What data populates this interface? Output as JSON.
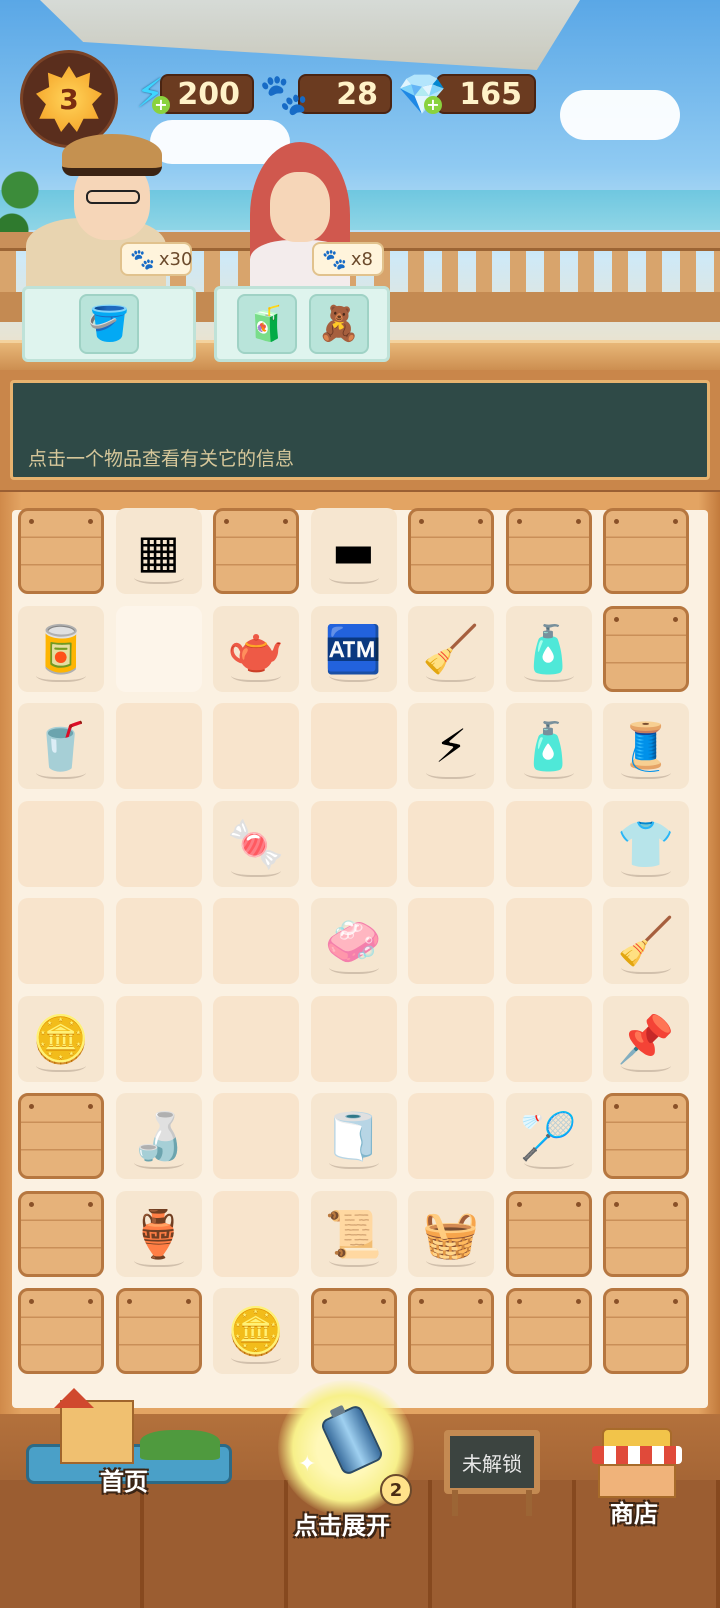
{
  "hud": {
    "level": "3",
    "energy": "200",
    "paws": "28",
    "gems": "165"
  },
  "customers": [
    {
      "name": "man-with-hat",
      "reward": "x30",
      "orders": [
        "bucket"
      ]
    },
    {
      "name": "woman-red-hair",
      "reward": "x8",
      "orders": [
        "juice-cup",
        "pink-towel"
      ]
    }
  ],
  "info": {
    "hint": "点击一个物品查看有关它的信息"
  },
  "board": {
    "rows": [
      [
        "crate",
        "grill",
        "crate",
        "plank",
        "crate",
        "crate",
        "crate"
      ],
      [
        "tin-can",
        "blank",
        "teapot",
        "vending-machine",
        "rake",
        "detergent-bag",
        "crate"
      ],
      [
        "soda-can",
        "empty",
        "empty",
        "empty",
        "energy-generator",
        "spray-bottle",
        "spool"
      ],
      [
        "empty",
        "empty",
        "candy",
        "empty",
        "empty",
        "empty",
        "tshirt"
      ],
      [
        "empty",
        "empty",
        "empty",
        "soap",
        "empty",
        "empty",
        "mop"
      ],
      [
        "coins",
        "empty",
        "empty",
        "empty",
        "empty",
        "empty",
        "pin"
      ],
      [
        "crate",
        "bottle",
        "empty",
        "torn-cloth",
        "empty",
        "badminton-racket",
        "crate"
      ],
      [
        "crate",
        "vase",
        "empty",
        "torn-paper",
        "folded-cloth",
        "crate",
        "crate"
      ],
      [
        "crate",
        "crate",
        "coins",
        "crate",
        "crate",
        "crate",
        "crate"
      ]
    ]
  },
  "icons": {
    "grill": "▦",
    "plank": "▬",
    "tin-can": "🥫",
    "teapot": "🫖",
    "vending-machine": "🏧",
    "rake": "🧹",
    "detergent-bag": "🧴",
    "soda-can": "🥤",
    "energy-generator": "⚡",
    "spray-bottle": "🧴",
    "spool": "🧵",
    "candy": "🍬",
    "tshirt": "👕",
    "soap": "🧼",
    "mop": "🧹",
    "coins": "🪙",
    "pin": "📌",
    "bottle": "🍶",
    "torn-cloth": "🧻",
    "badminton-racket": "🏸",
    "vase": "🏺",
    "torn-paper": "📜",
    "folded-cloth": "🧺",
    "bucket": "🪣",
    "juice-cup": "🧃",
    "pink-towel": "🧸",
    "energy-icon": "⚡",
    "paw-icon": "🐾",
    "gem-icon": "💎",
    "home-icon": "🏘",
    "battery-icon": "🔋",
    "shop-icon": "🏪"
  },
  "nav": {
    "home": "首页",
    "expand": "点击展开",
    "expand_count": "2",
    "locked": "未解锁",
    "shop": "商店"
  }
}
